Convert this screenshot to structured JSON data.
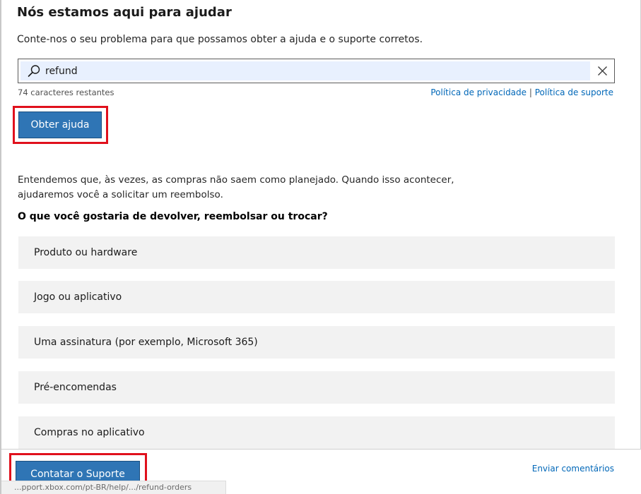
{
  "header": {
    "title": "Nós estamos aqui para ajudar",
    "subtitle": "Conte-nos o seu problema para que possamos obter a ajuda e o suporte corretos."
  },
  "search": {
    "value": "refund",
    "icon": "search-icon",
    "clear_icon": "close-icon",
    "remaining": "74 caracteres restantes"
  },
  "links": {
    "privacy": "Política de privacidade",
    "separator": " | ",
    "support_policy": "Política de suporte"
  },
  "actions": {
    "get_help": "Obter ajuda",
    "contact_support": "Contatar o Suporte",
    "feedback": "Enviar comentários"
  },
  "refund": {
    "intro": "Entendemos que, às vezes, as compras não saem como planejado. Quando isso acontecer, ajudaremos você a solicitar um reembolso.",
    "question": "O que você gostaria de devolver, reembolsar ou trocar?",
    "options": [
      {
        "label": "Produto ou hardware"
      },
      {
        "label": "Jogo ou aplicativo"
      },
      {
        "label": "Uma assinatura (por exemplo, Microsoft 365)"
      },
      {
        "label": "Pré-encomendas"
      },
      {
        "label": "Compras no aplicativo"
      }
    ]
  },
  "status_bar": {
    "url": "...pport.xbox.com/pt-BR/help/.../refund-orders"
  },
  "colors": {
    "primary_button": "#2f75b5",
    "link": "#0067b8",
    "highlight": "#e0101c",
    "option_bg": "#f2f2f2",
    "search_fill": "#e8f0fe"
  }
}
